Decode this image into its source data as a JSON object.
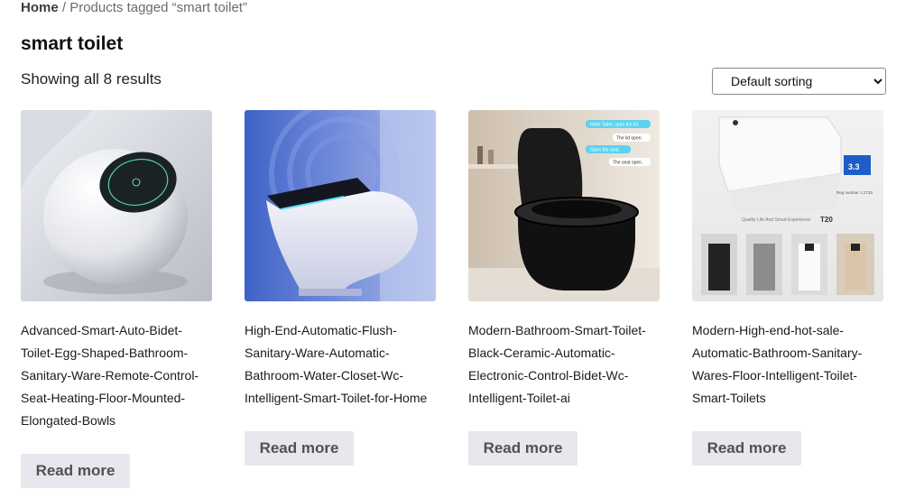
{
  "breadcrumb": {
    "home": "Home",
    "separator": " / ",
    "current": "Products tagged “smart toilet”"
  },
  "page_title": "smart toilet",
  "result_count": "Showing all 8 results",
  "sorting": {
    "selected": "Default sorting",
    "options": [
      "Default sorting"
    ]
  },
  "products": [
    {
      "title": "Advanced-Smart-Auto-Bidet-Toilet-Egg-Shaped-Bathroom-Sanitary-Ware-Remote-Control-Seat-Heating-Floor-Mounted-Elongated-Bowls",
      "button": "Read more"
    },
    {
      "title": "High-End-Automatic-Flush-Sanitary-Ware-Automatic-Bathroom-Water-Closet-Wc-Intelligent-Smart-Toilet-for-Home",
      "button": "Read more"
    },
    {
      "title": "Modern-Bathroom-Smart-Toilet-Black-Ceramic-Automatic-Electronic-Control-Bidet-Wc-Intelligent-Toilet-ai",
      "button": "Read more"
    },
    {
      "title": "Modern-High-end-hot-sale-Automatic-Bathroom-Sanitary-Wares-Floor-Intelligent-Toilet-Smart-Toilets",
      "button": "Read more"
    }
  ],
  "image_texts": {
    "p3_bubbles": [
      "Hello Toilet, open the lid.",
      "The lid open.",
      "Open the seat.",
      "The seat open."
    ],
    "p4_model": "T20",
    "p4_tagline": "Quality Life And Smart Experience",
    "p4_rating": "3.3",
    "p4_reg": "Reg number: L1T20"
  }
}
